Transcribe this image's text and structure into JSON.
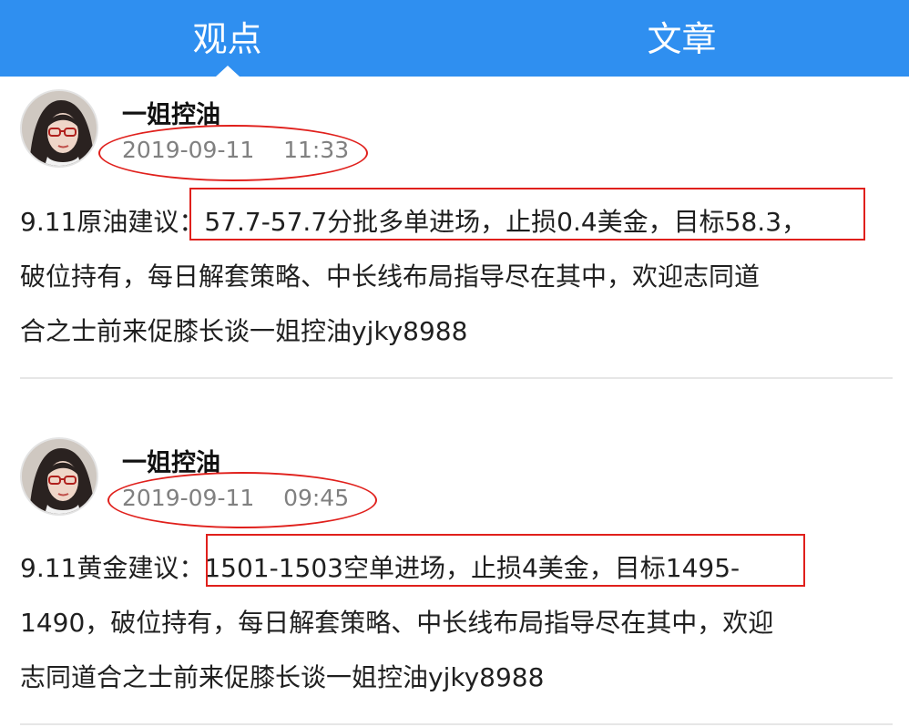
{
  "tabs": [
    {
      "label": "观点",
      "active": true
    },
    {
      "label": "文章",
      "active": false
    }
  ],
  "posts": [
    {
      "author": "一姐控油",
      "date": "2019-09-11",
      "time": "11:33",
      "timestamp": "2019-09-11    11:33",
      "lines": [
        "9.11原油建议：57.7-57.7分批多单进场，止损0.4美金，目标58.3，",
        "破位持有，每日解套策略、中长线布局指导尽在其中，欢迎志同道",
        "合之士前来促膝长谈一姐控油yjky8988"
      ]
    },
    {
      "author": "一姐控油",
      "date": "2019-09-11",
      "time": "09:45",
      "timestamp": "2019-09-11    09:45",
      "lines": [
        "9.11黄金建议：1501-1503空单进场，止损4美金，目标1495-",
        "1490，破位持有，每日解套策略、中长线布局指导尽在其中，欢迎",
        "志同道合之士前来促膝长谈一姐控油yjky8988"
      ]
    }
  ],
  "colors": {
    "tab_bar": "#2f8ff0",
    "annotation": "#e0201c",
    "timestamp": "#808080"
  }
}
